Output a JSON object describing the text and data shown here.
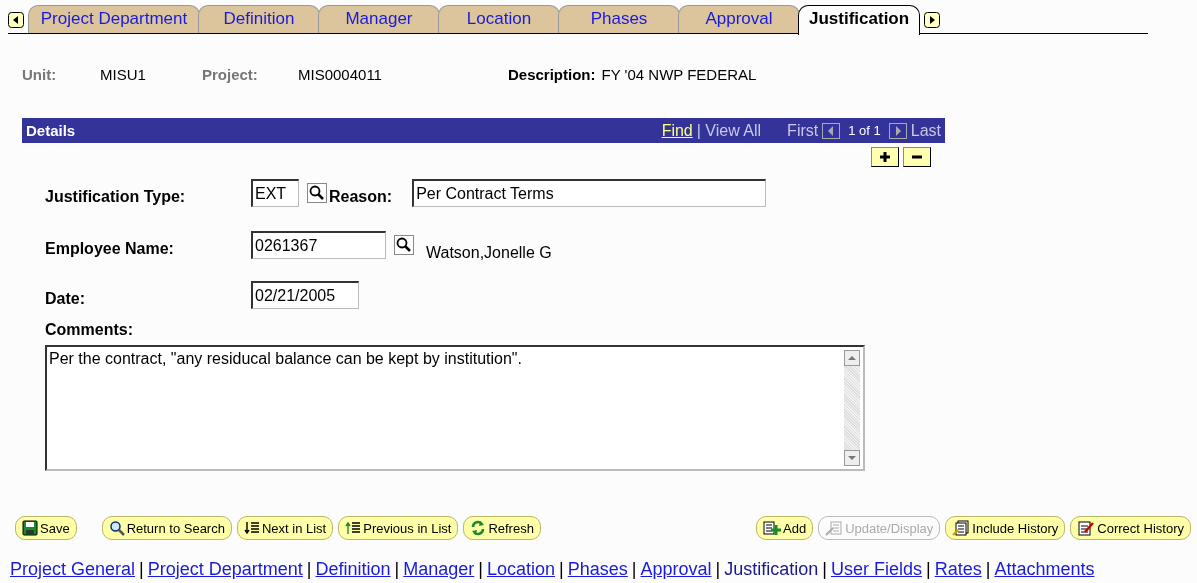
{
  "tabs": [
    {
      "label": "Project Department",
      "selected": false
    },
    {
      "label": "Definition",
      "selected": false
    },
    {
      "label": "Manager",
      "selected": false
    },
    {
      "label": "Location",
      "selected": false
    },
    {
      "label": "Phases",
      "selected": false
    },
    {
      "label": "Approval",
      "selected": false
    },
    {
      "label": "Justification",
      "selected": true
    }
  ],
  "header": {
    "unit_label": "Unit:",
    "unit": "MISU1",
    "project_label": "Project:",
    "project": "MIS0004011",
    "description_label": "Description:",
    "description": "FY '04 NWP FEDERAL"
  },
  "details": {
    "title": "Details",
    "find": "Find",
    "view_all": "| View All",
    "first": "First",
    "count": "1 of 1",
    "last": "Last",
    "justification_type_label": "Justification Type:",
    "justification_type": "EXT",
    "reason_label": "Reason:",
    "reason": "Per Contract Terms",
    "employee_label": "Employee Name:",
    "employee_id": "0261367",
    "employee_name": "Watson,Jonelle G",
    "date_label": "Date:",
    "date": "02/21/2005",
    "comments_label": "Comments:",
    "comments": "Per the contract, \"any residucal balance can be kept by institution\"."
  },
  "buttons": [
    {
      "kind": "save",
      "label": "Save",
      "disabled": false
    },
    {
      "kind": "search",
      "label": "Return to Search",
      "disabled": false
    },
    {
      "kind": "next",
      "label": "Next in List",
      "disabled": false
    },
    {
      "kind": "previous",
      "label": "Previous in List",
      "disabled": false
    },
    {
      "kind": "refresh",
      "label": "Refresh",
      "disabled": false
    },
    {
      "kind": "add",
      "label": "Add",
      "disabled": false
    },
    {
      "kind": "update",
      "label": "Update/Display",
      "disabled": true
    },
    {
      "kind": "include",
      "label": "Include History",
      "disabled": false
    },
    {
      "kind": "correct",
      "label": "Correct History",
      "disabled": false
    }
  ],
  "links": [
    {
      "label": "Project General",
      "selected": false
    },
    {
      "separator": "|",
      "label": "Project Department",
      "selected": false
    },
    {
      "separator": "|",
      "label": "Definition",
      "selected": false
    },
    {
      "separator": "|",
      "label": "Manager",
      "selected": false
    },
    {
      "separator": "|",
      "label": "Location",
      "selected": false
    },
    {
      "separator": "|",
      "label": "Phases",
      "selected": false
    },
    {
      "separator": "|",
      "label": "Approval",
      "selected": false
    },
    {
      "separator": "|",
      "label": "Justification",
      "selected": true
    },
    {
      "separator": "|",
      "label": "User Fields",
      "selected": false
    },
    {
      "separator": "|",
      "label": "Rates",
      "selected": false
    },
    {
      "separator": "|",
      "label": "Attachments",
      "selected": false
    }
  ]
}
